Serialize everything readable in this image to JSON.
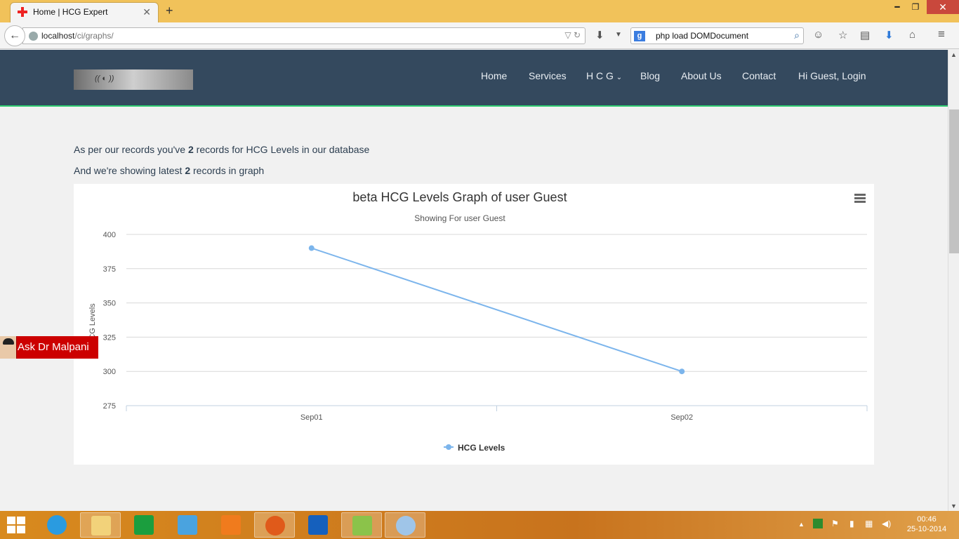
{
  "browser": {
    "tab_title": "Home | HCG Expert",
    "url_host": "localhost",
    "url_path": "/ci/graphs/",
    "search_text": "php load DOMDocument",
    "search_engine_letter": "g"
  },
  "site": {
    "menu": [
      "Home",
      "Services",
      "H C G",
      "Blog",
      "About Us",
      "Contact",
      "Hi Guest, Login"
    ],
    "intro1_pre": "As per our records you've ",
    "intro1_count": "2",
    "intro1_post": " records for HCG Levels in our database",
    "intro2_pre": "And we're showing latest ",
    "intro2_count": "2",
    "intro2_post": " records in graph",
    "ask_label": "Ask Dr Malpani"
  },
  "chart_data": {
    "type": "line",
    "title": "beta HCG Levels Graph of user Guest",
    "subtitle": "Showing For user Guest",
    "ylabel": "HCG Levels",
    "categories": [
      "Sep01",
      "Sep02"
    ],
    "series": [
      {
        "name": "HCG Levels",
        "values": [
          390,
          300
        ],
        "color": "#7cb5ec"
      }
    ],
    "ylim": [
      275,
      400
    ],
    "yticks": [
      400,
      375,
      350,
      325,
      300,
      275
    ],
    "grid": true,
    "legend": "bottom-center"
  },
  "taskbar": {
    "time": "00:46",
    "date": "25-10-2014"
  }
}
